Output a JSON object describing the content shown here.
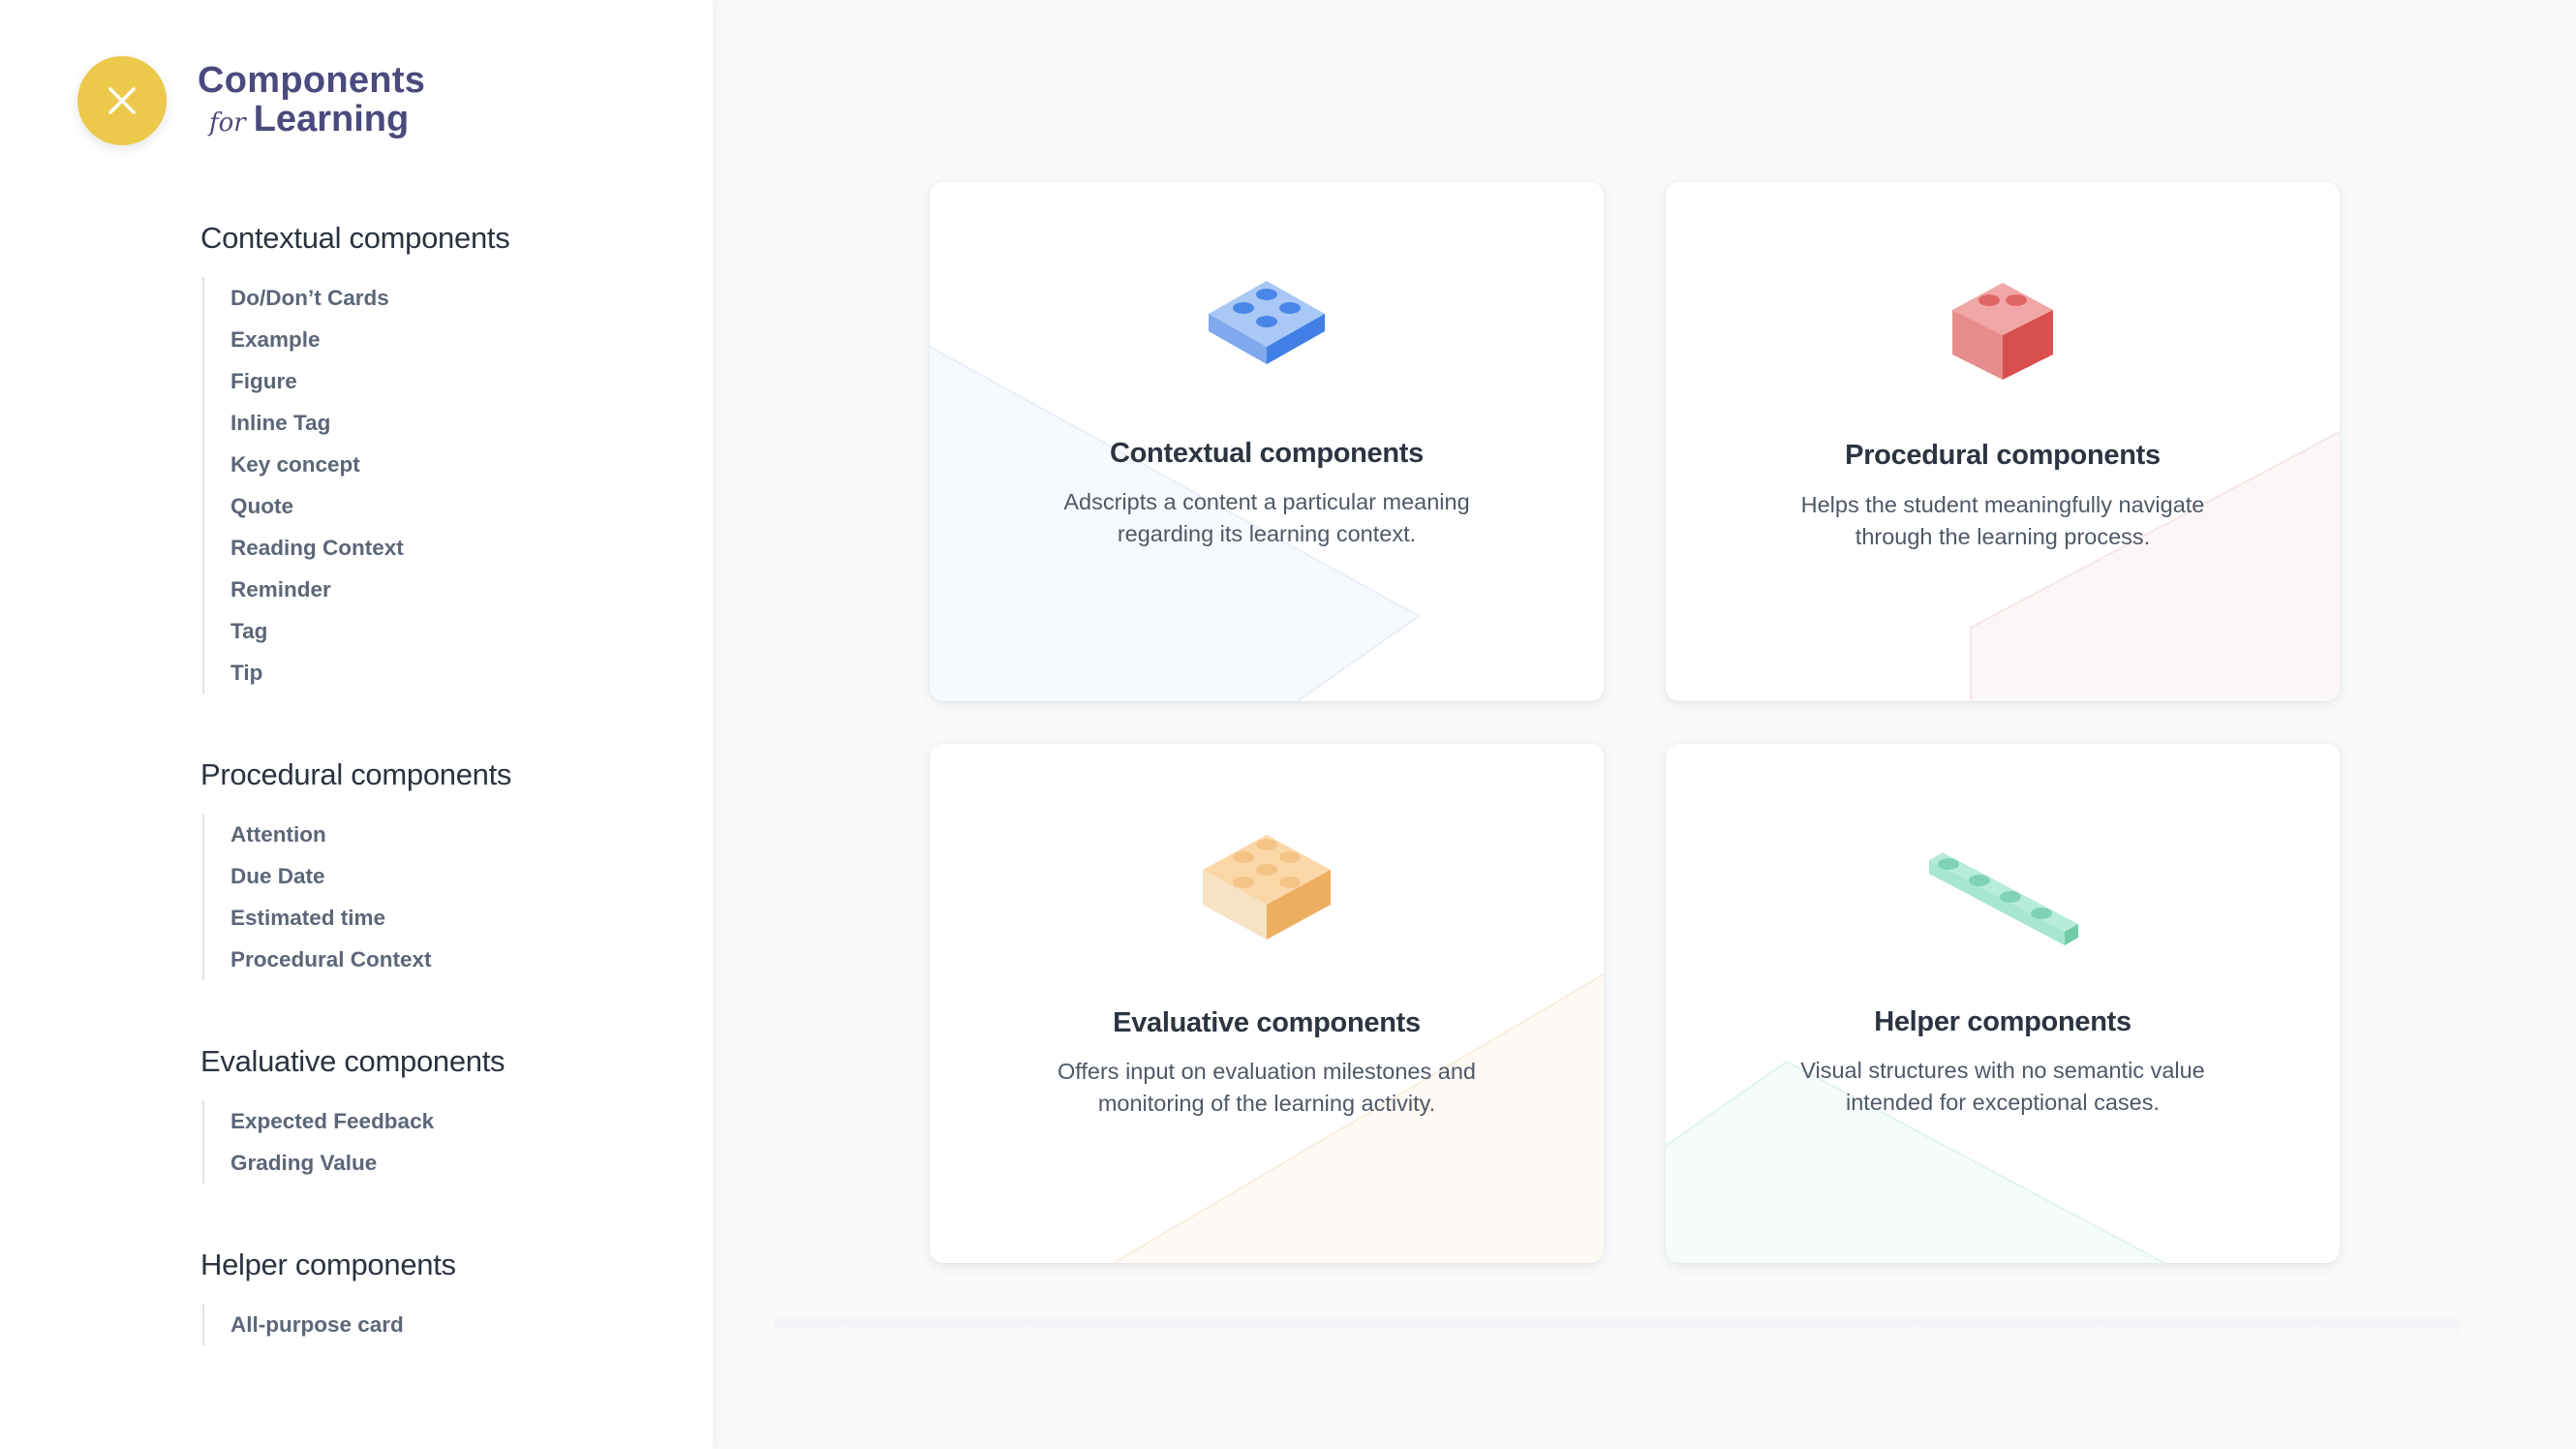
{
  "brand": {
    "line1": "Components",
    "for": "for",
    "line2": "Learning",
    "close_icon": "close-icon",
    "accent": "#ecc94b"
  },
  "nav": [
    {
      "heading": "Contextual components",
      "items": [
        "Do/Don’t Cards",
        "Example",
        "Figure",
        "Inline Tag",
        "Key concept",
        "Quote",
        "Reading Context",
        "Reminder",
        "Tag",
        "Tip"
      ]
    },
    {
      "heading": "Procedural components",
      "items": [
        "Attention",
        "Due Date",
        "Estimated time",
        "Procedural Context"
      ]
    },
    {
      "heading": "Evaluative components",
      "items": [
        "Expected Feedback",
        "Grading Value"
      ]
    },
    {
      "heading": "Helper components",
      "items": [
        "All-purpose card"
      ]
    }
  ],
  "cards": [
    {
      "title": "Contextual components",
      "desc": "Adscripts a content a particular meaning regarding its learning context.",
      "icon": "blue-brick-icon",
      "color": "#4a86e8"
    },
    {
      "title": "Procedural components",
      "desc": "Helps the student meaningfully navigate through the learning process.",
      "icon": "red-brick-icon",
      "color": "#e06666"
    },
    {
      "title": "Evaluative components",
      "desc": "Offers input on evaluation milestones and monitoring of the learning activity.",
      "icon": "orange-brick-icon",
      "color": "#f0b56a"
    },
    {
      "title": "Helper components",
      "desc": "Visual structures with no semantic value intended for exceptional cases.",
      "icon": "green-brick-icon",
      "color": "#8fdcc0"
    }
  ]
}
